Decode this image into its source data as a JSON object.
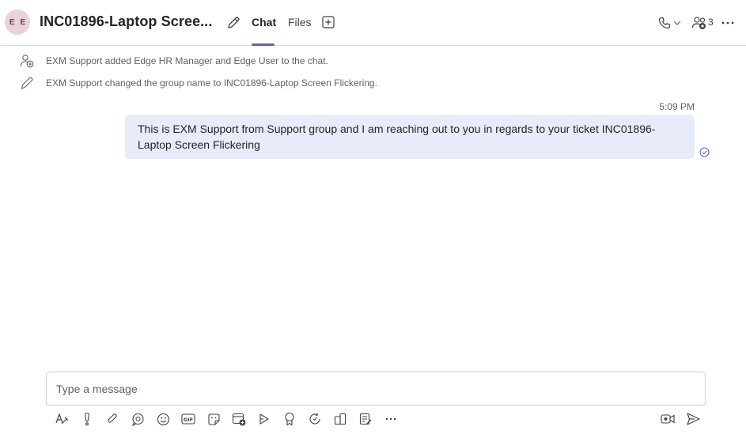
{
  "header": {
    "avatar_initials": [
      "E",
      "E"
    ],
    "title": "INC01896-Laptop Scree...",
    "tabs": [
      {
        "label": "Chat",
        "active": true
      },
      {
        "label": "Files",
        "active": false
      }
    ],
    "people_count": "3",
    "accent_color": "#5b5fc7"
  },
  "system_messages": [
    {
      "icon": "add-person-icon",
      "text": "EXM Support added Edge HR Manager and Edge User to the chat."
    },
    {
      "icon": "pencil-icon",
      "text": "EXM Support changed the group name to INC01896-Laptop Screen Flickering."
    }
  ],
  "message": {
    "time": "5:09 PM",
    "text_line1": "This is EXM Support from Support group and I am reaching out to you in regards to your ticket INC01896-",
    "text_line2": "Laptop Screen Flickering",
    "status_icon": "read-check-icon"
  },
  "compose": {
    "placeholder": "Type a message"
  },
  "toolbar_icons": [
    "format-icon",
    "important-icon",
    "attach-icon",
    "loop-icon",
    "emoji-icon",
    "gif-icon",
    "sticker-icon",
    "schedule-meeting-icon",
    "stream-icon",
    "praise-icon",
    "updates-icon",
    "apps-icon",
    "forms-icon",
    "more-icon"
  ]
}
